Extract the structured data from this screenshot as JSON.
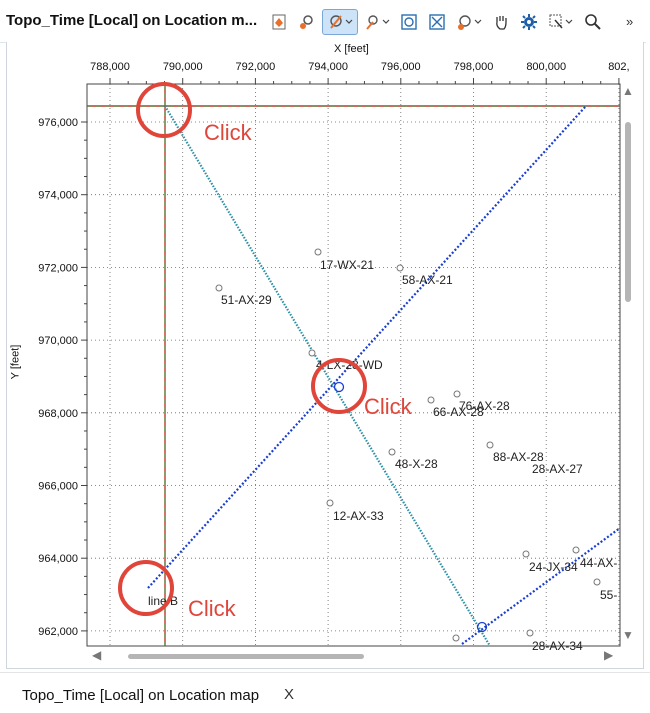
{
  "window": {
    "title": "Topo_Time [Local] on Location m..."
  },
  "toolbar": {
    "buttons": [
      {
        "name": "select-object-icon"
      },
      {
        "name": "pick-point-icon"
      },
      {
        "name": "draw-line-icon"
      },
      {
        "name": "interpret-icon"
      },
      {
        "name": "seismic-view-icon"
      },
      {
        "name": "zoom-extent-icon"
      },
      {
        "name": "well-icon"
      },
      {
        "name": "pan-hand-icon"
      },
      {
        "name": "settings-gear-icon"
      },
      {
        "name": "zoom-select-icon"
      },
      {
        "name": "magnifier-icon"
      }
    ],
    "more_label": "»"
  },
  "map": {
    "x_axis_title": "X [feet]",
    "y_axis_title": "Y [feet]",
    "x_ticks": [
      "788,000",
      "790,000",
      "792,000",
      "794,000",
      "796,000",
      "798,000",
      "800,000",
      "802,"
    ],
    "y_ticks": [
      "976,000",
      "974,000",
      "972,000",
      "970,000",
      "968,000",
      "966,000",
      "964,000",
      "962,000"
    ],
    "wells": [
      {
        "label": "17-WX-21"
      },
      {
        "label": "58-AX-21"
      },
      {
        "label": "51-AX-29"
      },
      {
        "label": "4-LX-28-WD"
      },
      {
        "label": "66-AX-28"
      },
      {
        "label": "76-AX-28"
      },
      {
        "label": "48-X-28"
      },
      {
        "label": "88-AX-28"
      },
      {
        "label": "28-AX-27"
      },
      {
        "label": "12-AX-33"
      },
      {
        "label": "24-JX-34"
      },
      {
        "label": "44-AX-"
      },
      {
        "label": "55-"
      },
      {
        "label": "28-AX-34"
      }
    ],
    "line_label": "line B",
    "colors": {
      "grid": "#555555",
      "line_a": "#2a8fa6",
      "line_b": "#1b3fd0",
      "crosshair_red": "#c0392b",
      "crosshair_green": "#2e8b2e",
      "annotation": "#e0453a"
    }
  },
  "annotations": {
    "click1": "Click",
    "click2": "Click",
    "click3": "Click"
  },
  "tab": {
    "label": "Topo_Time [Local] on Location map",
    "close": "X"
  }
}
